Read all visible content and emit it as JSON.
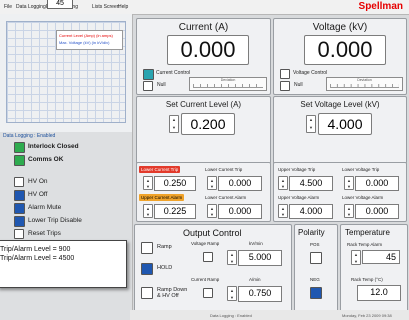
{
  "menu": {
    "items": [
      "File",
      "Data Logging",
      "Event Logging",
      "Lists Screen",
      "Help"
    ],
    "brand": "Spellman"
  },
  "top_counter": "45",
  "chart_legend": {
    "line1": "Current Level (Amp) (in amps)",
    "line2": "Max. Voltage (kV) (in kV/div)"
  },
  "left_panel": {
    "data_logging_status": "Data Logging : Enabled",
    "status": [
      {
        "label": "Interlock Closed",
        "color": "#2eab4f"
      },
      {
        "label": "Comms OK",
        "color": "#2eab4f"
      }
    ],
    "controls": [
      {
        "label": "HV On",
        "type": "checkbox"
      },
      {
        "label": "HV Off",
        "type": "led-blue"
      },
      {
        "label": "Alarm Mute",
        "type": "led-blue"
      },
      {
        "label": "Lower Trip Disable",
        "type": "led-blue"
      },
      {
        "label": "Reset Trips",
        "type": "checkbox"
      }
    ]
  },
  "overlay": {
    "line1": "Trip/Alarm Level = 900",
    "line2": "Trip/Alarm Level = 4500"
  },
  "current": {
    "title": "Current (A)",
    "value": "0.000",
    "control_label": "Current Control",
    "null_label": "Null",
    "deviation_label": "Deviation",
    "set_title": "Set Current Level (A)",
    "set_value": "0.200",
    "upper_trip_label": "Lower Current Trip",
    "upper_trip_tag": "Lower Current Trip",
    "upper_trip_value": "0.250",
    "lower_trip_label": "Lower Current Trip",
    "lower_trip_value": "0.000",
    "upper_alarm_tag": "Upper Current Alarm",
    "upper_alarm_value": "0.225",
    "lower_alarm_label": "Lower Current Alarm",
    "lower_alarm_value": "0.000"
  },
  "voltage": {
    "title": "Voltage (kV)",
    "value": "0.000",
    "control_label": "Voltage Control",
    "null_label": "Null",
    "deviation_label": "Deviation",
    "set_title": "Set Voltage Level (kV)",
    "set_value": "4.000",
    "upper_trip_label": "Upper Voltage Trip",
    "upper_trip_value": "4.500",
    "lower_trip_label": "Lower Voltage Trip",
    "lower_trip_value": "0.000",
    "upper_alarm_label": "Upper Voltage Alarm",
    "upper_alarm_value": "4.000",
    "lower_alarm_label": "Lower Voltage Alarm",
    "lower_alarm_value": "0.000"
  },
  "output_control": {
    "title": "Output Control",
    "ramp_label": "Ramp",
    "hold_label": "HOLD",
    "ramp_down_label": "Ramp Down & HV Off",
    "voltage_ramp_label": "Voltage Ramp",
    "kv_min_label": "kV/min",
    "kv_min_value": "5.000",
    "current_ramp_label": "Current Ramp",
    "a_min_label": "A/min",
    "a_min_value": "0.750"
  },
  "polarity": {
    "title": "Polarity",
    "pos_label": "POS",
    "neg_label": "NEG"
  },
  "temperature": {
    "title": "Temperature",
    "alarm_label": "Rack Temp Alarm",
    "alarm_value": "45",
    "temp_label": "Rack Temp (°C)",
    "temp_value": "12.0"
  },
  "statusbar": {
    "left": "Data Logging : Enabled",
    "right": "Monday, Feb 23 2009 09:38"
  }
}
